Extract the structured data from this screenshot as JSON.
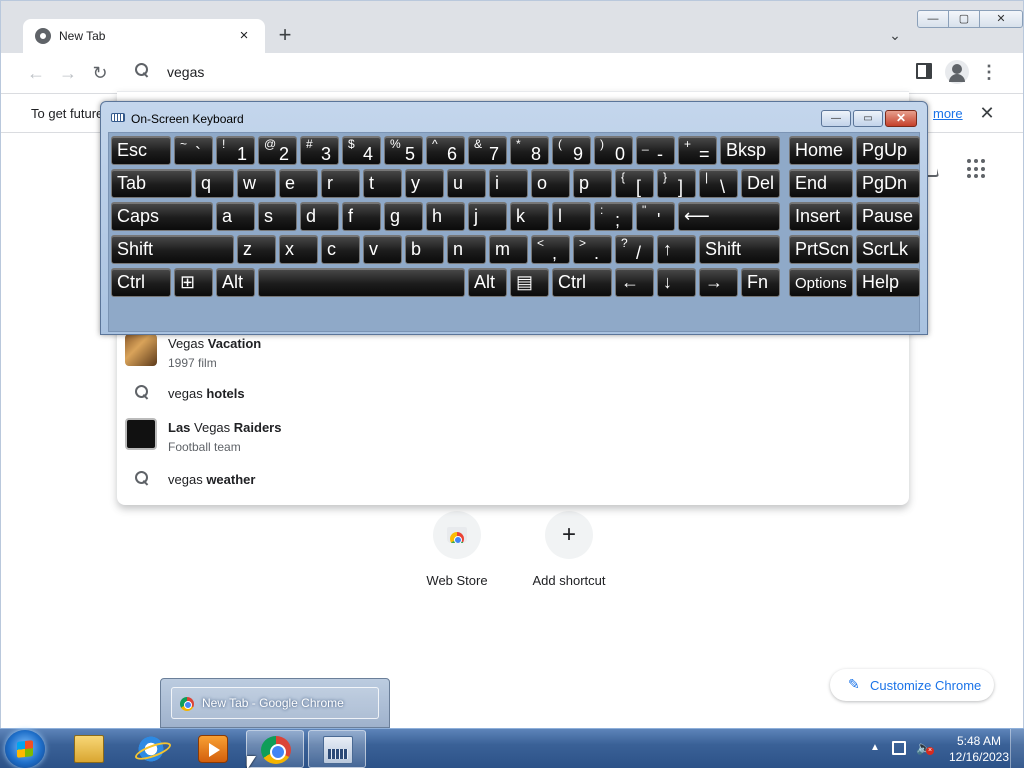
{
  "browser": {
    "tab_title": "New Tab",
    "tab_close": "×",
    "new_tab": "+",
    "tab_search": "⌄",
    "window_controls": {
      "minimize": "—",
      "maximize": "▢",
      "close": "✕"
    },
    "nav": {
      "back": "←",
      "forward": "→",
      "reload": "↻"
    },
    "omnibox_value": "vegas",
    "menu": "⋮",
    "infobar": {
      "text": "To get future",
      "link": "more",
      "close": "✕"
    }
  },
  "suggestions": [
    {
      "type": "entity",
      "bold_prefix": "",
      "text_normal": "Vegas",
      "text_bold": " Vacation",
      "subtitle": "1997 film",
      "icon": "movie-thumbnail"
    },
    {
      "type": "search",
      "text_normal": "vegas",
      "text_bold": " hotels",
      "icon": "search-icon"
    },
    {
      "type": "entity",
      "text_bold_first": "Las",
      "text_normal": " Vegas",
      "text_bold": " Raiders",
      "subtitle": "Football team",
      "icon": "team-logo"
    },
    {
      "type": "search",
      "text_normal": "vegas",
      "text_bold": " weather",
      "icon": "search-icon"
    }
  ],
  "shortcuts": [
    {
      "label": "Web Store",
      "icon": "webstore-icon"
    },
    {
      "label": "Add shortcut",
      "icon": "add-icon",
      "glyph": "+"
    }
  ],
  "customize": {
    "label": "Customize Chrome",
    "icon": "✎"
  },
  "osk": {
    "title": "On-Screen Keyboard",
    "controls": {
      "minimize": "—",
      "restore": "▭",
      "close": "✕"
    },
    "rows": [
      [
        {
          "l": "Esc",
          "w": 60
        },
        {
          "s": "~",
          "m": "`",
          "w": 39
        },
        {
          "s": "!",
          "m": "1",
          "w": 39
        },
        {
          "s": "@",
          "m": "2",
          "w": 39
        },
        {
          "s": "#",
          "m": "3",
          "w": 39
        },
        {
          "s": "$",
          "m": "4",
          "w": 39
        },
        {
          "s": "%",
          "m": "5",
          "w": 39
        },
        {
          "s": "^",
          "m": "6",
          "w": 39
        },
        {
          "s": "&",
          "m": "7",
          "w": 39
        },
        {
          "s": "*",
          "m": "8",
          "w": 39
        },
        {
          "s": "(",
          "m": "9",
          "w": 39
        },
        {
          "s": ")",
          "m": "0",
          "w": 39
        },
        {
          "s": "_",
          "m": "-",
          "w": 39
        },
        {
          "s": "+",
          "m": "=",
          "w": 39
        },
        {
          "l": "Bksp",
          "w": 60
        },
        {
          "gap": 6
        },
        {
          "l": "Home",
          "w": 64
        },
        {
          "l": "PgUp",
          "w": 64
        }
      ],
      [
        {
          "l": "Tab",
          "w": 81
        },
        {
          "l": "q",
          "w": 39
        },
        {
          "l": "w",
          "w": 39
        },
        {
          "l": "e",
          "w": 39
        },
        {
          "l": "r",
          "w": 39
        },
        {
          "l": "t",
          "w": 39
        },
        {
          "l": "y",
          "w": 39
        },
        {
          "l": "u",
          "w": 39
        },
        {
          "l": "i",
          "w": 39
        },
        {
          "l": "o",
          "w": 39
        },
        {
          "l": "p",
          "w": 39
        },
        {
          "s": "{",
          "m": "[",
          "w": 39
        },
        {
          "s": "}",
          "m": "]",
          "w": 39
        },
        {
          "s": "|",
          "m": "\\",
          "w": 39
        },
        {
          "l": "Del",
          "w": 39
        },
        {
          "gap": 6
        },
        {
          "l": "End",
          "w": 64
        },
        {
          "l": "PgDn",
          "w": 64
        }
      ],
      [
        {
          "l": "Caps",
          "w": 102
        },
        {
          "l": "a",
          "w": 39
        },
        {
          "l": "s",
          "w": 39
        },
        {
          "l": "d",
          "w": 39
        },
        {
          "l": "f",
          "w": 39
        },
        {
          "l": "g",
          "w": 39
        },
        {
          "l": "h",
          "w": 39
        },
        {
          "l": "j",
          "w": 39
        },
        {
          "l": "k",
          "w": 39
        },
        {
          "l": "l",
          "w": 39
        },
        {
          "s": ":",
          "m": ";",
          "w": 39
        },
        {
          "s": "\"",
          "m": "'",
          "w": 39
        },
        {
          "l": "⟵",
          "w": 102
        },
        {
          "gap": 6
        },
        {
          "l": "Insert",
          "w": 64
        },
        {
          "l": "Pause",
          "w": 64
        }
      ],
      [
        {
          "l": "Shift",
          "w": 123
        },
        {
          "l": "z",
          "w": 39
        },
        {
          "l": "x",
          "w": 39
        },
        {
          "l": "c",
          "w": 39
        },
        {
          "l": "v",
          "w": 39
        },
        {
          "l": "b",
          "w": 39
        },
        {
          "l": "n",
          "w": 39
        },
        {
          "l": "m",
          "w": 39
        },
        {
          "s": "<",
          "m": ",",
          "w": 39
        },
        {
          "s": ">",
          "m": ".",
          "w": 39
        },
        {
          "s": "?",
          "m": "/",
          "w": 39
        },
        {
          "l": "↑",
          "w": 39
        },
        {
          "l": "Shift",
          "w": 81
        },
        {
          "gap": 6
        },
        {
          "l": "PrtScn",
          "w": 64
        },
        {
          "l": "ScrLk",
          "w": 64
        }
      ],
      [
        {
          "l": "Ctrl",
          "w": 60
        },
        {
          "l": "⊞",
          "w": 39
        },
        {
          "l": "Alt",
          "w": 39
        },
        {
          "l": "",
          "w": 207
        },
        {
          "l": "Alt",
          "w": 39
        },
        {
          "l": "▤",
          "w": 39
        },
        {
          "l": "Ctrl",
          "w": 60
        },
        {
          "l": "←",
          "w": 39
        },
        {
          "l": "↓",
          "w": 39
        },
        {
          "l": "→",
          "w": 39
        },
        {
          "l": "Fn",
          "w": 39
        },
        {
          "gap": 6
        },
        {
          "l": "Options",
          "w": 64,
          "small": true
        },
        {
          "l": "Help",
          "w": 64
        }
      ]
    ]
  },
  "taskbar": {
    "preview_label": "New Tab - Google Chrome",
    "apps": [
      {
        "name": "windows-explorer",
        "active": false
      },
      {
        "name": "internet-explorer",
        "active": false
      },
      {
        "name": "windows-media-player",
        "active": false
      },
      {
        "name": "google-chrome",
        "active": true
      },
      {
        "name": "on-screen-keyboard",
        "active": true
      }
    ],
    "tray_arrow": "▲",
    "time": "5:48 AM",
    "date": "12/16/2023"
  }
}
